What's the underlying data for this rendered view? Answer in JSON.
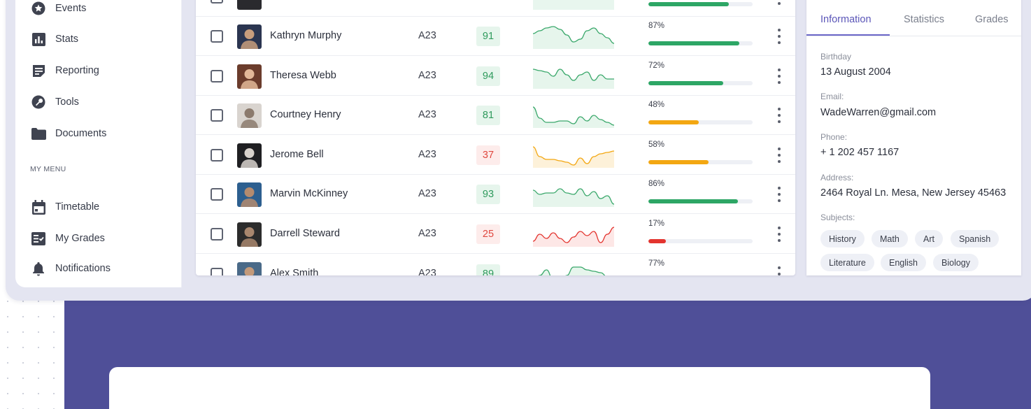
{
  "sidebar": {
    "items": [
      {
        "label": "Events",
        "icon": "star-badge-icon"
      },
      {
        "label": "Stats",
        "icon": "bar-chart-icon"
      },
      {
        "label": "Reporting",
        "icon": "note-icon"
      },
      {
        "label": "Tools",
        "icon": "wrench-icon"
      },
      {
        "label": "Documents",
        "icon": "folder-icon"
      }
    ],
    "section_heading": "MY MENU",
    "menu_items": [
      {
        "label": "Timetable",
        "icon": "calendar-icon"
      },
      {
        "label": "My Grades",
        "icon": "grades-icon"
      },
      {
        "label": "Notifications",
        "icon": "bell-icon"
      }
    ]
  },
  "students": [
    {
      "name": "Kathryn Murphy",
      "group": "A23",
      "score": "91",
      "score_status": "good",
      "progress": 87,
      "progress_label": "87%",
      "trend": "up",
      "spark": [
        20,
        24,
        28,
        30,
        26,
        18,
        8,
        12,
        24,
        28,
        20,
        14,
        6
      ],
      "avatar": "avatar-kathryn"
    },
    {
      "name": "Theresa Webb",
      "group": "A23",
      "score": "94",
      "score_status": "good",
      "progress": 72,
      "progress_label": "72%",
      "trend": "up",
      "spark": [
        26,
        24,
        22,
        16,
        26,
        18,
        10,
        18,
        22,
        10,
        18,
        12,
        12
      ],
      "avatar": "avatar-theresa"
    },
    {
      "name": "Courtney Henry",
      "group": "A23",
      "score": "81",
      "score_status": "good",
      "progress": 48,
      "progress_label": "48%",
      "trend": "up",
      "spark": [
        28,
        12,
        6,
        6,
        8,
        8,
        4,
        14,
        8,
        16,
        10,
        6,
        2
      ],
      "avatar": "avatar-courtney"
    },
    {
      "name": "Jerome Bell",
      "group": "A23",
      "score": "37",
      "score_status": "bad",
      "progress": 58,
      "progress_label": "58%",
      "trend": "neutral",
      "spark": [
        28,
        14,
        10,
        10,
        8,
        6,
        2,
        12,
        4,
        14,
        18,
        20,
        22
      ],
      "avatar": "avatar-jerome"
    },
    {
      "name": "Marvin McKinney",
      "group": "A23",
      "score": "93",
      "score_status": "good",
      "progress": 86,
      "progress_label": "86%",
      "trend": "up",
      "spark": [
        22,
        16,
        18,
        18,
        24,
        18,
        16,
        24,
        14,
        20,
        10,
        14,
        2
      ],
      "avatar": "avatar-marvin"
    },
    {
      "name": "Darrell Steward",
      "group": "A23",
      "score": "25",
      "score_status": "bad",
      "progress": 17,
      "progress_label": "17%",
      "trend": "down",
      "spark": [
        6,
        16,
        10,
        18,
        10,
        4,
        12,
        20,
        14,
        20,
        4,
        16,
        26
      ],
      "avatar": "avatar-darrell"
    },
    {
      "name": "Alex Smith",
      "group": "A23",
      "score": "89",
      "score_status": "good",
      "progress": 77,
      "progress_label": "77%",
      "trend": "up",
      "spark": [
        6,
        14,
        22,
        8,
        4,
        14,
        26,
        26,
        22,
        20,
        18,
        12,
        6
      ],
      "avatar": "avatar-alex"
    }
  ],
  "colors": {
    "good_fill": "#2da665",
    "mid_fill": "#f3a712",
    "bad_fill": "#e3342f",
    "good_text": "#2e9a5c",
    "good_bg": "#e6f5ec",
    "bad_text": "#e0473f",
    "bad_bg": "#fdeceb",
    "accent": "#5b56b8"
  },
  "info": {
    "tabs": [
      "Information",
      "Statistics",
      "Grades"
    ],
    "active_tab": "Information",
    "birthday_label": "Birthday",
    "birthday": "13 August 2004",
    "email_label": "Email:",
    "email": "WadeWarren@gmail.com",
    "phone_label": "Phone:",
    "phone": "+ 1 202 457 1167",
    "address_label": "Address:",
    "address": "2464 Royal Ln. Mesa, New Jersey 45463",
    "subjects_label": "Subjects:",
    "subjects": [
      "History",
      "Math",
      "Art",
      "Spanish",
      "Literature",
      "English",
      "Biology"
    ]
  }
}
